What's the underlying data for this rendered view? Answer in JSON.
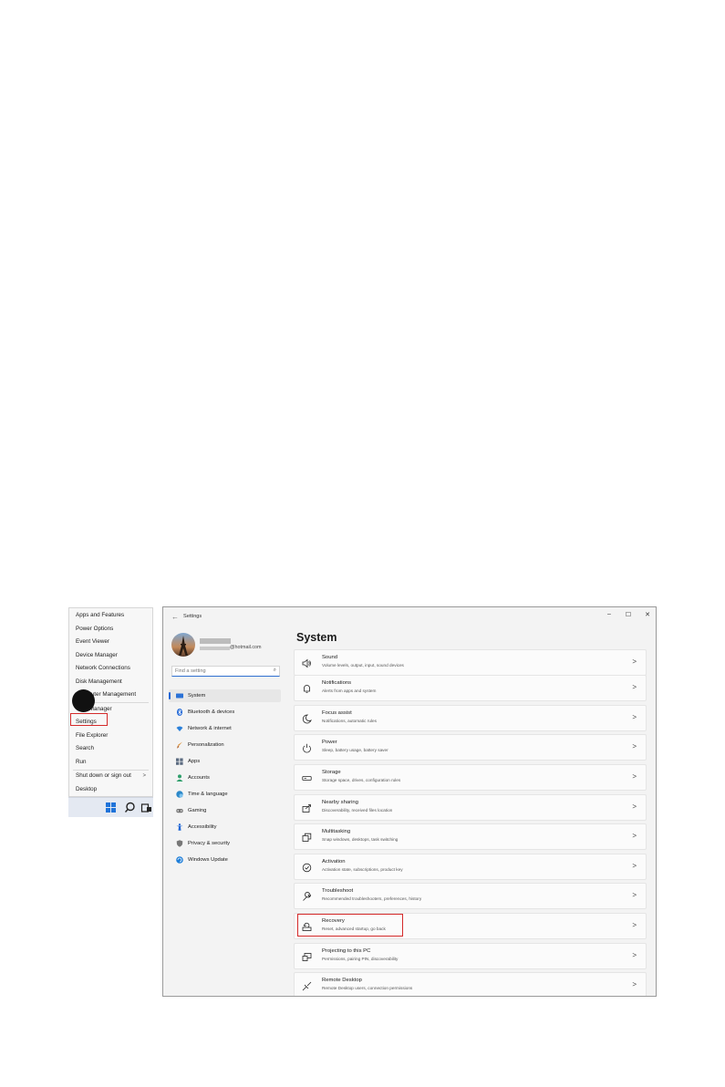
{
  "context_menu": {
    "items": [
      {
        "label": "Apps and Features",
        "submenu": false
      },
      {
        "label": "Power Options",
        "submenu": false
      },
      {
        "label": "Event Viewer",
        "submenu": false
      },
      {
        "label": "Device Manager",
        "submenu": false
      },
      {
        "label": "Network Connections",
        "submenu": false
      },
      {
        "label": "Disk Management",
        "submenu": false
      },
      {
        "label": "Computer Management",
        "submenu": false
      },
      {
        "label": "Task Manager",
        "submenu": false
      },
      {
        "label": "Settings",
        "submenu": false
      },
      {
        "label": "File Explorer",
        "submenu": false
      },
      {
        "label": "Search",
        "submenu": false
      },
      {
        "label": "Run",
        "submenu": false
      },
      {
        "label": "Shut down or sign out",
        "submenu": true,
        "arrow": ">"
      },
      {
        "label": "Desktop",
        "submenu": false
      }
    ]
  },
  "taskbar": {
    "icons": [
      "windows-start-icon",
      "search-icon",
      "task-view-icon"
    ]
  },
  "settings_window": {
    "title": "Settings",
    "back_glyph": "←",
    "controls": {
      "minimize": "–",
      "maximize": "☐",
      "close": "✕"
    },
    "profile": {
      "email_suffix": "@hotmail.com"
    },
    "search": {
      "placeholder": "Find a setting",
      "icon": "⌕"
    },
    "page_title": "System",
    "nav": [
      {
        "label": "System",
        "icon": "system-icon",
        "color": "#2b72d6",
        "active": true
      },
      {
        "label": "Bluetooth & devices",
        "icon": "bluetooth-icon",
        "color": "#1f66d6",
        "active": false
      },
      {
        "label": "Network & internet",
        "icon": "wifi-icon",
        "color": "#2b80d9",
        "active": false
      },
      {
        "label": "Personalization",
        "icon": "brush-icon",
        "color": "#d98a2b",
        "active": false
      },
      {
        "label": "Apps",
        "icon": "apps-icon",
        "color": "#5b6b80",
        "active": false
      },
      {
        "label": "Accounts",
        "icon": "accounts-icon",
        "color": "#2e9e6b",
        "active": false
      },
      {
        "label": "Time & language",
        "icon": "globe-clock-icon",
        "color": "#2b88c9",
        "active": false
      },
      {
        "label": "Gaming",
        "icon": "gamepad-icon",
        "color": "#777777",
        "active": false
      },
      {
        "label": "Accessibility",
        "icon": "accessibility-icon",
        "color": "#1f66d6",
        "active": false
      },
      {
        "label": "Privacy & security",
        "icon": "shield-icon",
        "color": "#777777",
        "active": false
      },
      {
        "label": "Windows Update",
        "icon": "update-icon",
        "color": "#1f7fd9",
        "active": false
      }
    ],
    "cards": [
      {
        "title": "Sound",
        "subtitle": "Volume levels, output, input, sound devices",
        "icon": "speaker-icon"
      },
      {
        "title": "Notifications",
        "subtitle": "Alerts from apps and system",
        "icon": "bell-icon"
      },
      {
        "title": "Focus assist",
        "subtitle": "Notifications, automatic rules",
        "icon": "moon-icon"
      },
      {
        "title": "Power",
        "subtitle": "Sleep, battery usage, battery saver",
        "icon": "power-icon"
      },
      {
        "title": "Storage",
        "subtitle": "Storage space, drives, configuration rules",
        "icon": "drive-icon"
      },
      {
        "title": "Nearby sharing",
        "subtitle": "Discoverability, received files location",
        "icon": "share-icon"
      },
      {
        "title": "Multitasking",
        "subtitle": "Snap windows, desktops, task switching",
        "icon": "multitask-icon"
      },
      {
        "title": "Activation",
        "subtitle": "Activation state, subscriptions, product key",
        "icon": "check-circle-icon"
      },
      {
        "title": "Troubleshoot",
        "subtitle": "Recommended troubleshooters, preferences, history",
        "icon": "wrench-icon"
      },
      {
        "title": "Recovery",
        "subtitle": "Reset, advanced startup, go back",
        "icon": "recovery-icon"
      },
      {
        "title": "Projecting to this PC",
        "subtitle": "Permissions, pairing PIN, discoverability",
        "icon": "projector-icon"
      },
      {
        "title": "Remote Desktop",
        "subtitle": "Remote Desktop users, connection permissions",
        "icon": "remote-desktop-icon"
      }
    ],
    "chevron": ">"
  },
  "colors": {
    "highlight": "#d42a2a",
    "accent": "#1f66d6",
    "step_marker": "#111111"
  }
}
